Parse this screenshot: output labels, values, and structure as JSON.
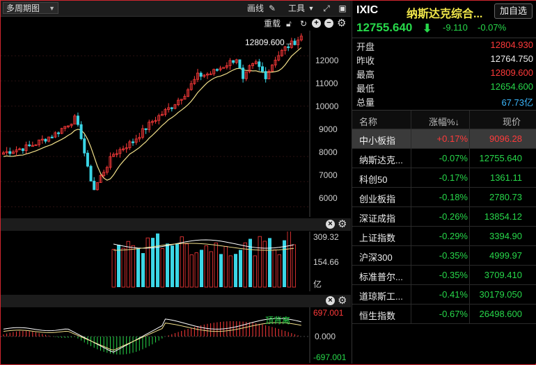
{
  "toolbar": {
    "period_label": "多周期图",
    "draw_label": "画线",
    "tools_label": "工具"
  },
  "chart_toolbar": {
    "reset_label": "重载"
  },
  "chart_data": [
    {
      "type": "candlestick",
      "annotation": "12809.600→",
      "y_ticks": [
        "12000",
        "11000",
        "10000",
        "9000",
        "8000",
        "7000",
        "6000"
      ],
      "ylim": [
        5600,
        13000
      ]
    },
    {
      "type": "bar",
      "y_ticks": [
        "309.32",
        "154.66"
      ],
      "unit": "亿"
    },
    {
      "type": "bar",
      "annotation": "顶背离",
      "y_ticks": [
        "697.001",
        "0.000",
        "-697.001"
      ]
    }
  ],
  "quote": {
    "code": "IXIC",
    "name": "纳斯达克综合...",
    "add_label": "加自选",
    "price": "12755.640",
    "change": "-9.110",
    "change_pct": "-0.07%",
    "stats": [
      {
        "label": "开盘",
        "value": "12804.930",
        "color": "red"
      },
      {
        "label": "昨收",
        "value": "12764.750",
        "color": "white"
      },
      {
        "label": "最高",
        "value": "12809.600",
        "color": "red"
      },
      {
        "label": "最低",
        "value": "12654.600",
        "color": "green"
      },
      {
        "label": "总量",
        "value": "67.73亿",
        "color": "cyan"
      }
    ]
  },
  "table": {
    "headers": [
      "名称",
      "涨幅%↓",
      "现价"
    ],
    "rows": [
      {
        "name": "中小板指",
        "pct": "+0.17%",
        "price": "9096.28",
        "color": "red"
      },
      {
        "name": "纳斯达克...",
        "pct": "-0.07%",
        "price": "12755.640",
        "color": "green"
      },
      {
        "name": "科创50",
        "pct": "-0.17%",
        "price": "1361.11",
        "color": "green"
      },
      {
        "name": "创业板指",
        "pct": "-0.18%",
        "price": "2780.73",
        "color": "green"
      },
      {
        "name": "深证成指",
        "pct": "-0.26%",
        "price": "13854.12",
        "color": "green"
      },
      {
        "name": "上证指数",
        "pct": "-0.29%",
        "price": "3394.90",
        "color": "green"
      },
      {
        "name": "沪深300",
        "pct": "-0.35%",
        "price": "4999.97",
        "color": "green"
      },
      {
        "name": "标准普尔...",
        "pct": "-0.35%",
        "price": "3709.410",
        "color": "green"
      },
      {
        "name": "道琼斯工...",
        "pct": "-0.41%",
        "price": "30179.050",
        "color": "green"
      },
      {
        "name": "恒生指数",
        "pct": "-0.67%",
        "price": "26498.600",
        "color": "green"
      }
    ]
  }
}
